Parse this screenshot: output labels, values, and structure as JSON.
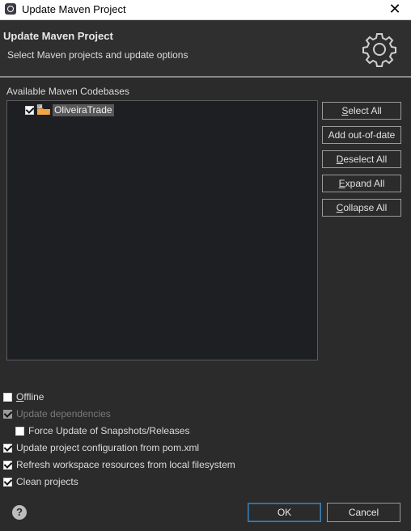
{
  "window": {
    "title": "Update Maven Project",
    "close_glyph": "✕"
  },
  "header": {
    "title": "Update Maven Project",
    "description": "Select Maven projects and update options",
    "icon": "gear-icon"
  },
  "codebases": {
    "label": "Available Maven Codebases",
    "items": [
      {
        "label": "OliveiraTrade",
        "checked": true,
        "icon": "maven-project-folder-icon"
      }
    ]
  },
  "side_buttons": [
    {
      "mnemonic": "S",
      "rest": "elect All"
    },
    {
      "mnemonic": "",
      "rest": "Add out-of-date"
    },
    {
      "mnemonic": "D",
      "rest": "eselect All"
    },
    {
      "mnemonic": "E",
      "rest": "xpand All"
    },
    {
      "mnemonic": "C",
      "rest": "ollapse All"
    }
  ],
  "options": {
    "offline": {
      "mnemonic": "O",
      "rest": "ffline",
      "checked": false
    },
    "update_dependencies": {
      "label": "Update dependencies",
      "checked": true,
      "enabled": false
    },
    "force_update": {
      "label": "Force Update of Snapshots/Releases",
      "checked": false
    },
    "update_config": {
      "label": "Update project configuration from pom.xml",
      "checked": true
    },
    "refresh_workspace": {
      "label": "Refresh workspace resources from local filesystem",
      "checked": true
    },
    "clean_projects": {
      "label": "Clean projects",
      "checked": true
    }
  },
  "footer": {
    "help_glyph": "?",
    "ok_label": "OK",
    "cancel_label": "Cancel"
  },
  "colors": {
    "background": "#2b2b2b",
    "tree_background": "#1e1f22",
    "ok_border": "#3c7fb1"
  }
}
